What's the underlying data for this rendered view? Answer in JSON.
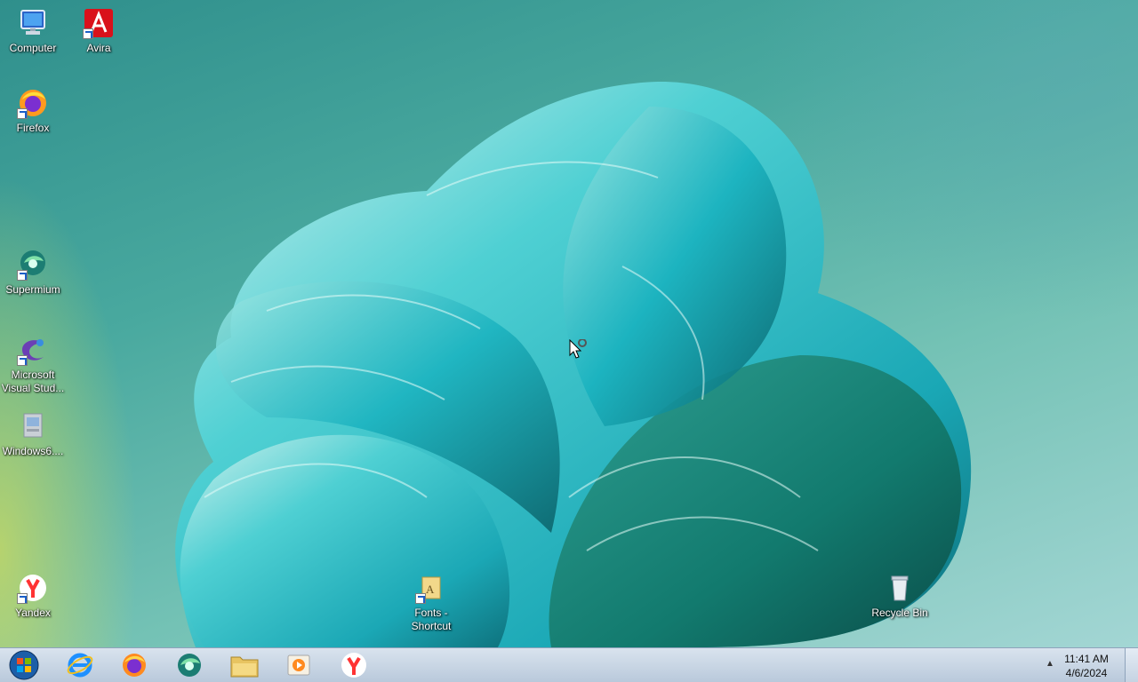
{
  "desktop": {
    "icons": [
      {
        "name": "computer",
        "label": "Computer",
        "icon": "computer-icon"
      },
      {
        "name": "avira",
        "label": "Avira",
        "icon": "avira-icon"
      },
      {
        "name": "firefox",
        "label": "Firefox",
        "icon": "firefox-icon"
      },
      {
        "name": "supermium",
        "label": "Supermium",
        "icon": "supermium-icon"
      },
      {
        "name": "visual-studio",
        "label": "Microsoft Visual Stud...",
        "icon": "visual-studio-icon"
      },
      {
        "name": "windows6",
        "label": "Windows6....",
        "icon": "installer-icon"
      },
      {
        "name": "yandex",
        "label": "Yandex",
        "icon": "yandex-icon"
      },
      {
        "name": "fonts-shortcut",
        "label": "Fonts - Shortcut",
        "icon": "folder-icon"
      },
      {
        "name": "recycle-bin",
        "label": "Recycle Bin",
        "icon": "recycle-bin-icon"
      }
    ]
  },
  "taskbar": {
    "start": "start-orb-icon",
    "pinned": [
      "internet-explorer-icon",
      "firefox-icon",
      "supermium-icon",
      "file-explorer-icon",
      "media-player-icon",
      "yandex-icon"
    ],
    "tray_arrow": "▲",
    "clock_time": "11:41 AM",
    "clock_date": "4/6/2024"
  },
  "colors": {
    "taskbar": "#c9d6e5",
    "accent": "#2a8c88"
  }
}
